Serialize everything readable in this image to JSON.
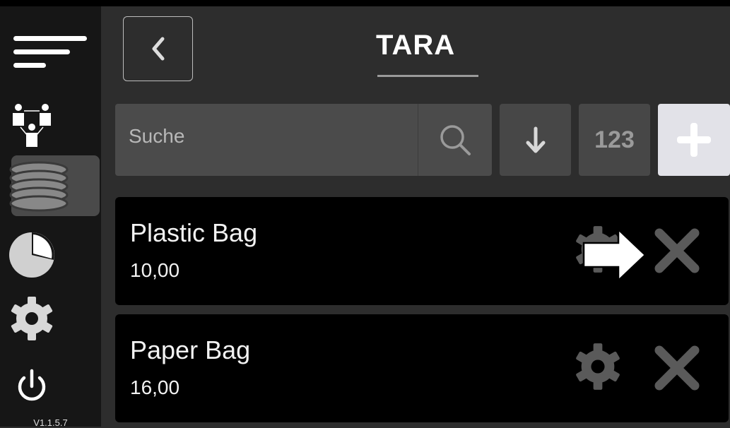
{
  "app": {
    "version": "V1.1.5.7"
  },
  "header": {
    "title": "TARA",
    "back_icon": "chevron-left-icon"
  },
  "sidebar": {
    "items": [
      {
        "icon": "menu-icon",
        "active": false
      },
      {
        "icon": "users-icon",
        "active": false
      },
      {
        "icon": "tare-stack-icon",
        "active": true
      },
      {
        "icon": "pie-chart-icon",
        "active": false
      },
      {
        "icon": "gear-icon",
        "active": false
      },
      {
        "icon": "power-icon",
        "active": false
      }
    ]
  },
  "toolbar": {
    "search_placeholder": "Suche",
    "sort_icon": "arrow-down-icon",
    "number_label": "123",
    "add_icon": "plus-icon"
  },
  "items": [
    {
      "name": "Plastic Bag",
      "value": "10,00"
    },
    {
      "name": "Paper Bag",
      "value": "16,00"
    }
  ],
  "colors": {
    "background": "#2d2d2d",
    "sidebar": "#161616",
    "card": "#000000",
    "accent_button": "#e2e2e8"
  }
}
